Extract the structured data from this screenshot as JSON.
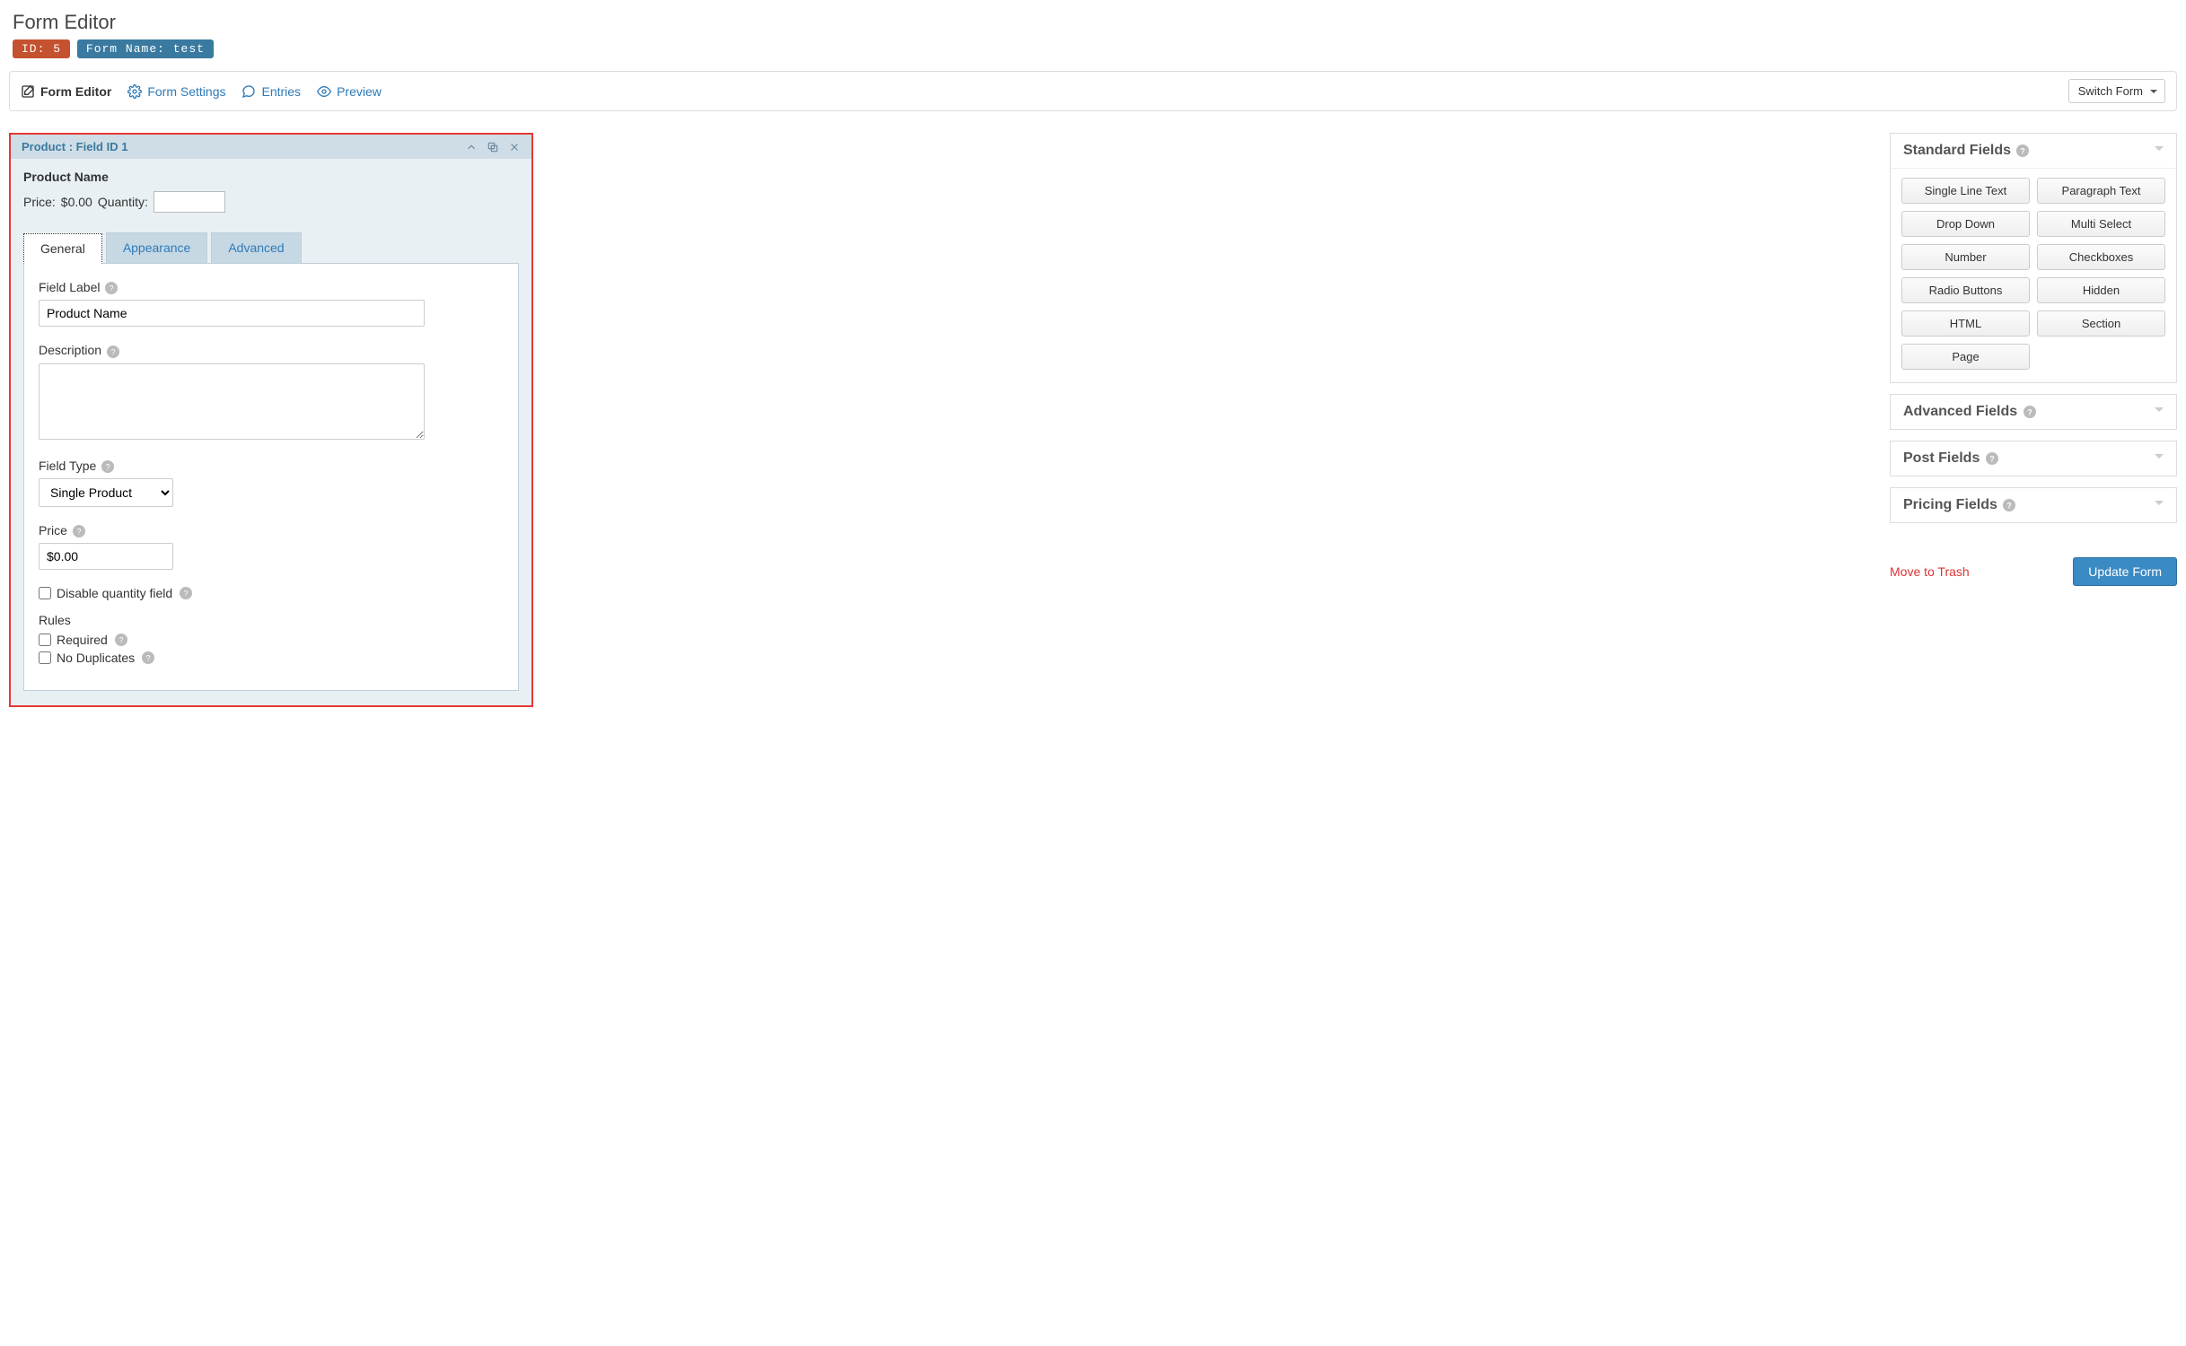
{
  "page": {
    "title": "Form Editor"
  },
  "badges": {
    "id": "ID: 5",
    "form_name": "Form Name: test"
  },
  "toolbar": {
    "switch_form": "Switch Form",
    "tabs": [
      {
        "label": "Form Editor",
        "name": "tab-form-editor",
        "active": true
      },
      {
        "label": "Form Settings",
        "name": "tab-form-settings",
        "active": false
      },
      {
        "label": "Entries",
        "name": "tab-entries",
        "active": false
      },
      {
        "label": "Preview",
        "name": "tab-preview",
        "active": false
      }
    ]
  },
  "field_card": {
    "header": "Product : Field ID 1",
    "preview": {
      "title": "Product Name",
      "price_label": "Price:",
      "price_value": "$0.00",
      "qty_label": "Quantity:"
    },
    "inner_tabs": {
      "general": "General",
      "appearance": "Appearance",
      "advanced": "Advanced"
    },
    "general": {
      "field_label_label": "Field Label",
      "field_label_value": "Product Name",
      "description_label": "Description",
      "description_value": "",
      "field_type_label": "Field Type",
      "field_type_value": "Single Product",
      "price_label": "Price",
      "price_value": "$0.00",
      "disable_qty_label": "Disable quantity field",
      "rules_heading": "Rules",
      "required_label": "Required",
      "no_duplicates_label": "No Duplicates"
    }
  },
  "sidebar": {
    "standard_header": "Standard Fields",
    "advanced_header": "Advanced Fields",
    "post_header": "Post Fields",
    "pricing_header": "Pricing Fields",
    "standard_fields": [
      "Single Line Text",
      "Paragraph Text",
      "Drop Down",
      "Multi Select",
      "Number",
      "Checkboxes",
      "Radio Buttons",
      "Hidden",
      "HTML",
      "Section",
      "Page"
    ],
    "trash_label": "Move to Trash",
    "update_label": "Update Form"
  }
}
